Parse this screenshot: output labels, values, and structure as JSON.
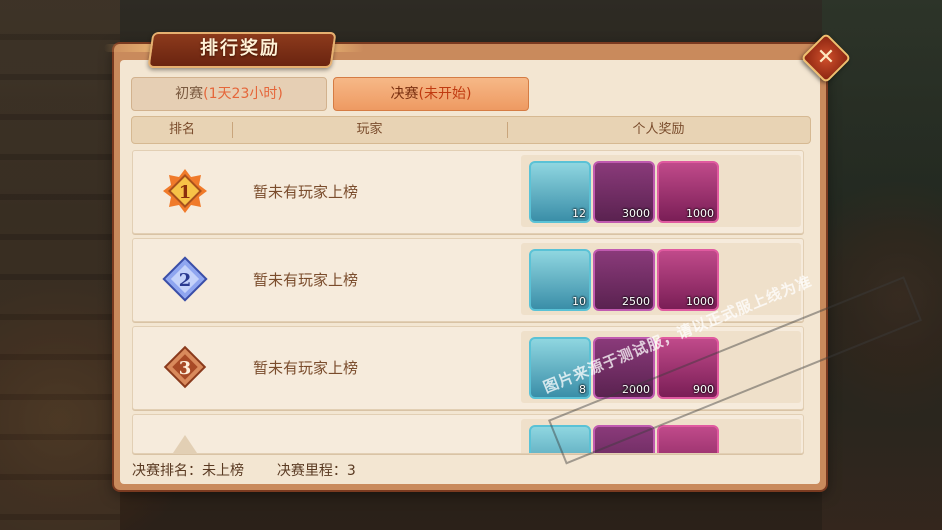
{
  "title": "排行奖励",
  "tabs": [
    {
      "label": "初赛",
      "status": "(1天23小时)"
    },
    {
      "label": "决赛",
      "status": "(未开始)"
    }
  ],
  "columns": [
    "排名",
    "玩家",
    "个人奖励"
  ],
  "rows": [
    {
      "rank": "1",
      "player": "暂未有玩家上榜",
      "rewards": [
        {
          "icon": "treasure-chest-icon",
          "count": "12"
        },
        {
          "icon": "anchor-coin-icon",
          "count": "3000"
        },
        {
          "icon": "orb-icon",
          "count": "1000"
        }
      ]
    },
    {
      "rank": "2",
      "player": "暂未有玩家上榜",
      "rewards": [
        {
          "icon": "treasure-chest-icon",
          "count": "10"
        },
        {
          "icon": "anchor-coin-icon",
          "count": "2500"
        },
        {
          "icon": "orb-icon",
          "count": "1000"
        }
      ]
    },
    {
      "rank": "3",
      "player": "暂未有玩家上榜",
      "rewards": [
        {
          "icon": "treasure-chest-icon",
          "count": "8"
        },
        {
          "icon": "anchor-coin-icon",
          "count": "2000"
        },
        {
          "icon": "orb-icon",
          "count": "900"
        }
      ]
    }
  ],
  "footer": {
    "rank_label": "决赛排名：",
    "rank_value": "未上榜",
    "mileage_label": "决赛里程：",
    "mileage_value": "3"
  },
  "watermark": "图片来源于测试服，请以正式服上线为准",
  "colors": {
    "accent": "#ee9a62",
    "panel": "#f3e6d2",
    "title_plate": "#8c3a1c"
  }
}
